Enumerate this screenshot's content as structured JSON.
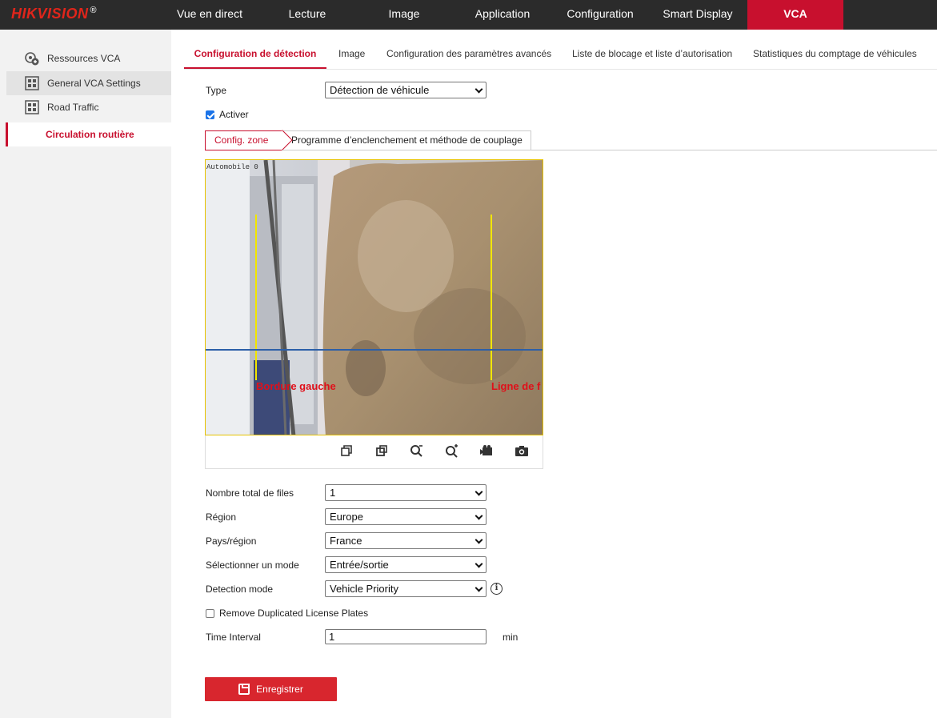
{
  "brand": {
    "name": "HIKVISION",
    "mark": "®"
  },
  "topnav": {
    "items": [
      "Vue en direct",
      "Lecture",
      "Image",
      "Application",
      "Configuration",
      "Smart Display",
      "VCA"
    ],
    "active": "VCA"
  },
  "sidebar": {
    "items": [
      "Ressources VCA",
      "General VCA Settings",
      "Road Traffic"
    ],
    "sub_item": "Circulation routière"
  },
  "tabs": [
    "Configuration de détection",
    "Image",
    "Configuration des paramètres avancés",
    "Liste de blocage et liste d’autorisation",
    "Statistiques du comptage de véhicules"
  ],
  "form": {
    "type_label": "Type",
    "type_value": "Détection de véhicule",
    "enable_label": "Activer",
    "enable_checked": true,
    "lanes_label": "Nombre total de files",
    "lanes_value": "1",
    "region_label": "Région",
    "region_value": "Europe",
    "country_label": "Pays/région",
    "country_value": "France",
    "mode_label": "Sélectionner un mode",
    "mode_value": "Entrée/sortie",
    "detection_mode_label": "Detection mode",
    "detection_mode_value": "Vehicle Priority",
    "remove_dup_label": "Remove Duplicated License Plates",
    "remove_dup_checked": false,
    "interval_label": "Time Interval",
    "interval_value": "1",
    "interval_unit": "min"
  },
  "subtabs": {
    "zone": "Config. zone",
    "schedule": "Programme d’enclenchement et méthode de couplage"
  },
  "video": {
    "left_border_label": "Bordure gauche",
    "right_line_label": "Ligne de f"
  },
  "toolbar_icons": [
    "window-restore-icon",
    "window-stack-icon",
    "zoom-out-icon",
    "zoom-in-icon",
    "video-camera-icon",
    "camera-snapshot-icon"
  ],
  "save_label": "Enregistrer",
  "colors": {
    "accent": "#c8102e",
    "topbar": "#2b2b2b",
    "sidebar": "#f2f2f2",
    "line_yellow": "#f2e600",
    "line_blue": "#2c5fa8"
  }
}
